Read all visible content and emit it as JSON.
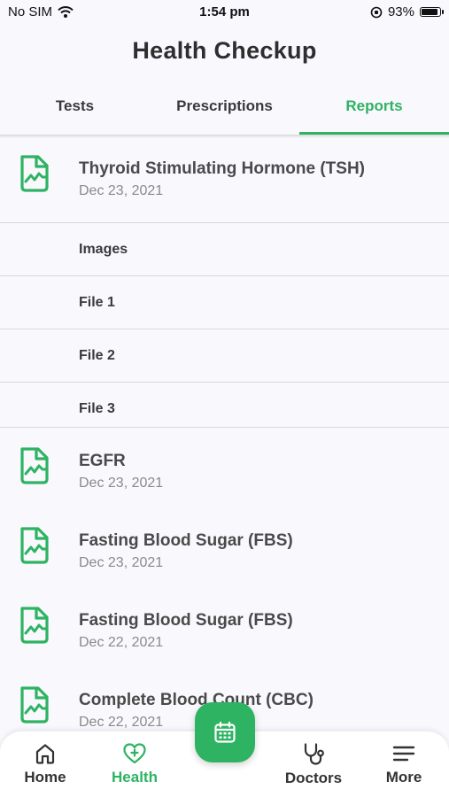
{
  "status_bar": {
    "carrier": "No SIM",
    "time": "1:54 pm",
    "battery": "93%",
    "battery_level": 0.93
  },
  "header": {
    "title": "Health Checkup"
  },
  "tabs": [
    {
      "label": "Tests",
      "active": false
    },
    {
      "label": "Prescriptions",
      "active": false
    },
    {
      "label": "Reports",
      "active": true
    }
  ],
  "reports": [
    {
      "title": "Thyroid Stimulating Hormone (TSH)",
      "date": "Dec 23, 2021",
      "expanded": true,
      "attachments": {
        "header": "Images",
        "files": [
          "File 1",
          "File 2",
          "File 3"
        ]
      }
    },
    {
      "title": "EGFR",
      "date": "Dec 23, 2021"
    },
    {
      "title": "Fasting Blood Sugar (FBS)",
      "date": "Dec 23, 2021"
    },
    {
      "title": "Fasting Blood Sugar (FBS)",
      "date": "Dec 22, 2021"
    },
    {
      "title": "Complete Blood Count (CBC)",
      "date": "Dec 22, 2021"
    }
  ],
  "bottom_nav": {
    "items": [
      {
        "label": "Home",
        "icon": "home-icon",
        "active": false
      },
      {
        "label": "Health",
        "icon": "heart-plus-icon",
        "active": true
      },
      {
        "label": "Doctors",
        "icon": "stethoscope-icon",
        "active": false
      },
      {
        "label": "More",
        "icon": "menu-icon",
        "active": false
      }
    ],
    "fab_icon": "calendar-icon"
  },
  "colors": {
    "accent": "#2db362",
    "background": "#f9f8fd",
    "text": "#3a3a3a",
    "muted": "#8a8a8a"
  }
}
